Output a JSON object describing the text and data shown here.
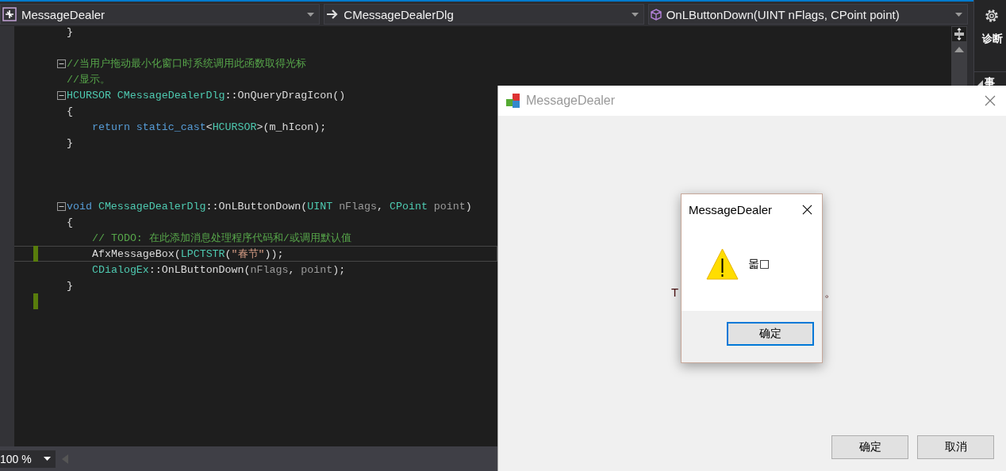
{
  "toolbar": {
    "dropdowns": [
      {
        "kind": "project",
        "label": "MessageDealer"
      },
      {
        "kind": "class",
        "label": "CMessageDealerDlg"
      },
      {
        "kind": "member",
        "label": "OnLButtonDown(UINT nFlags, CPoint point)"
      }
    ]
  },
  "editor": {
    "lines": [
      {
        "kind": "code",
        "tokens": [
          {
            "kind": "plain",
            "text": "}"
          }
        ]
      },
      {
        "kind": "blank"
      },
      {
        "kind": "code",
        "fold": true,
        "tokens": [
          {
            "kind": "comment",
            "text": "//当用户拖动最小化窗口时系统调用此函数取得光标"
          }
        ]
      },
      {
        "kind": "code",
        "tokens": [
          {
            "kind": "comment",
            "text": "//显示。"
          }
        ]
      },
      {
        "kind": "code",
        "fold": true,
        "tokens": [
          {
            "kind": "type",
            "text": "HCURSOR"
          },
          {
            "kind": "type",
            "text": " CMessageDealerDlg"
          },
          {
            "kind": "plain",
            "text": "::OnQueryDragIcon()"
          }
        ]
      },
      {
        "kind": "code",
        "tokens": [
          {
            "kind": "plain",
            "text": "{"
          }
        ]
      },
      {
        "kind": "code",
        "indented": true,
        "tokens": [
          {
            "kind": "keyword",
            "text": "return"
          },
          {
            "kind": "keyword",
            "text": " static_cast"
          },
          {
            "kind": "plain",
            "text": "<"
          },
          {
            "kind": "type",
            "text": "HCURSOR"
          },
          {
            "kind": "plain",
            "text": ">(m_hIcon);"
          }
        ]
      },
      {
        "kind": "code",
        "tokens": [
          {
            "kind": "plain",
            "text": "}"
          }
        ]
      },
      {
        "kind": "blank"
      },
      {
        "kind": "blank"
      },
      {
        "kind": "blank"
      },
      {
        "kind": "code",
        "fold": true,
        "tokens": [
          {
            "kind": "keyword",
            "text": "void"
          },
          {
            "kind": "type",
            "text": " CMessageDealerDlg"
          },
          {
            "kind": "plain",
            "text": "::OnLButtonDown("
          },
          {
            "kind": "type",
            "text": "UINT"
          },
          {
            "kind": "param",
            "text": " nFlags"
          },
          {
            "kind": "plain",
            "text": ","
          },
          {
            "kind": "type",
            "text": " CPoint"
          },
          {
            "kind": "param",
            "text": " point"
          },
          {
            "kind": "plain",
            "text": ")"
          }
        ]
      },
      {
        "kind": "code",
        "tokens": [
          {
            "kind": "plain",
            "text": "{"
          }
        ]
      },
      {
        "kind": "code",
        "indented": true,
        "tokens": [
          {
            "kind": "comment",
            "text": "// TODO: 在此添加消息处理程序代码和/或调用默认值"
          }
        ]
      },
      {
        "kind": "code",
        "changed": true,
        "current": true,
        "indented": true,
        "tokens": [
          {
            "kind": "plain",
            "text": "AfxMessageBox("
          },
          {
            "kind": "type",
            "text": "LPCTSTR"
          },
          {
            "kind": "plain",
            "text": "("
          },
          {
            "kind": "string",
            "text": "\"春节\""
          },
          {
            "kind": "plain",
            "text": "));"
          }
        ]
      },
      {
        "kind": "code",
        "indented": true,
        "tokens": [
          {
            "kind": "type",
            "text": "CDialogEx"
          },
          {
            "kind": "plain",
            "text": "::OnLButtonDown("
          },
          {
            "kind": "param",
            "text": "nFlags"
          },
          {
            "kind": "plain",
            "text": ","
          },
          {
            "kind": "param",
            "text": " point"
          },
          {
            "kind": "plain",
            "text": ");"
          }
        ]
      },
      {
        "kind": "code",
        "tokens": [
          {
            "kind": "plain",
            "text": "}"
          }
        ]
      },
      {
        "kind": "blank",
        "changed": true
      }
    ]
  },
  "right_panel": {
    "title": "诊断",
    "section": "事"
  },
  "status_bar": {
    "zoom": "100 %"
  },
  "dialog": {
    "title": "MessageDealer",
    "active": false,
    "static_text": [
      "T",
      "。"
    ],
    "buttons": [
      {
        "label": "确定",
        "focused": false
      },
      {
        "label": "取消",
        "focused": false
      }
    ]
  },
  "message_box": {
    "kind": "warning",
    "title": "MessageDealer",
    "text": "몳□",
    "buttons": [
      {
        "label": "确定",
        "focused": true
      }
    ]
  }
}
